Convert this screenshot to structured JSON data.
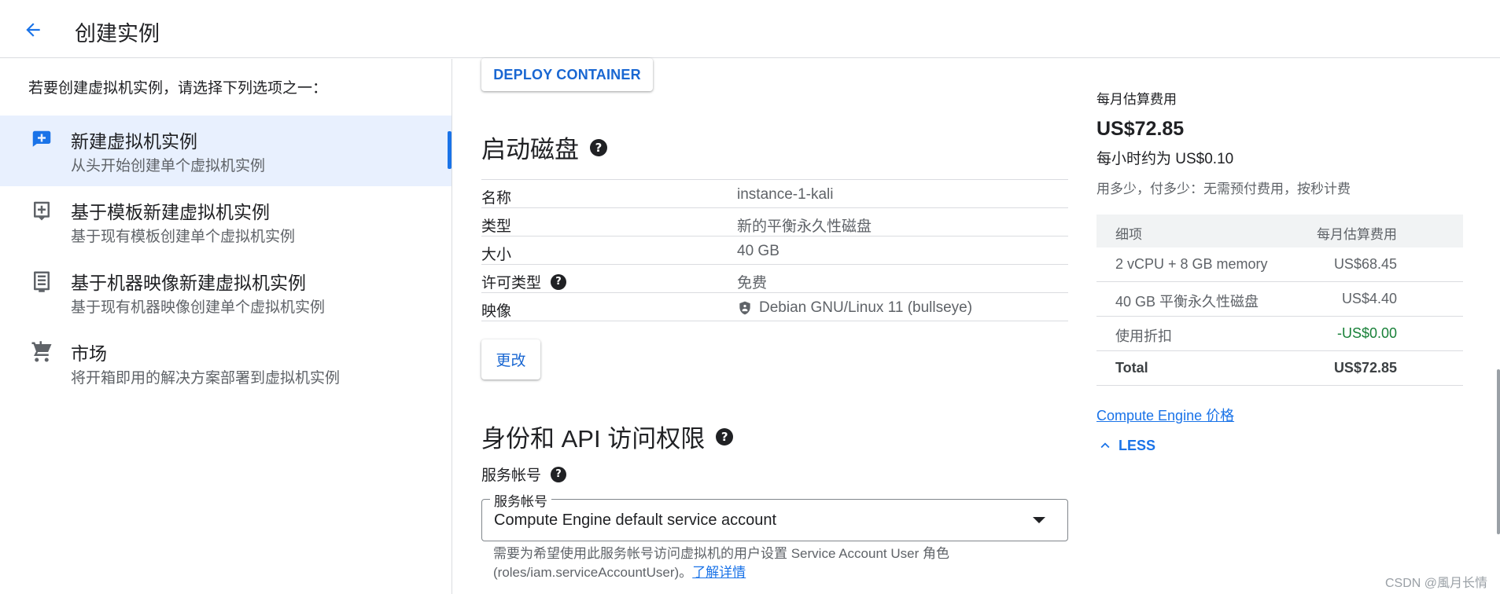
{
  "header": {
    "title": "创建实例"
  },
  "left": {
    "intro": "若要创建虚拟机实例，请选择下列选项之一：",
    "options": [
      {
        "title": "新建虚拟机实例",
        "subtitle": "从头开始创建单个虚拟机实例",
        "icon": "add-box-icon",
        "selected": true
      },
      {
        "title": "基于模板新建虚拟机实例",
        "subtitle": "基于现有模板创建单个虚拟机实例",
        "icon": "template-icon",
        "selected": false
      },
      {
        "title": "基于机器映像新建虚拟机实例",
        "subtitle": "基于现有机器映像创建单个虚拟机实例",
        "icon": "machine-image-icon",
        "selected": false
      },
      {
        "title": "市场",
        "subtitle": "将开箱即用的解决方案部署到虚拟机实例",
        "icon": "cart-icon",
        "selected": false
      }
    ]
  },
  "main": {
    "deploy_button": "DEPLOY CONTAINER",
    "boot_disk": {
      "title": "启动磁盘",
      "rows": [
        {
          "key": "名称",
          "value": "instance-1-kali"
        },
        {
          "key": "类型",
          "value": "新的平衡永久性磁盘"
        },
        {
          "key": "大小",
          "value": "40 GB"
        },
        {
          "key": "许可类型",
          "value": "免费"
        },
        {
          "key": "映像",
          "value": "Debian GNU/Linux 11 (bullseye)"
        }
      ],
      "change_button": "更改"
    },
    "identity": {
      "title": "身份和 API 访问权限",
      "sa_label": "服务帐号",
      "sa_float_label": "服务帐号",
      "sa_value": "Compute Engine default service account",
      "note": "需要为希望使用此服务帐号访问虚拟机的用户设置 Service Account User 角色 (roles/iam.serviceAccountUser)。",
      "note_link": "了解详情"
    }
  },
  "pricing": {
    "monthly_label": "每月估算费用",
    "monthly_price": "US$72.85",
    "hourly": "每小时约为 US$0.10",
    "note": "用多少，付多少：无需预付费用，按秒计费",
    "table_header": {
      "item": "细项",
      "cost": "每月估算费用"
    },
    "rows": [
      {
        "item": "2 vCPU + 8 GB memory",
        "cost": "US$68.45"
      },
      {
        "item": "40 GB 平衡永久性磁盘",
        "cost": "US$4.40"
      },
      {
        "item": "使用折扣",
        "cost": "-US$0.00"
      },
      {
        "item": "Total",
        "cost": "US$72.85"
      }
    ],
    "link": "Compute Engine 价格",
    "less_button": "LESS"
  },
  "watermark": "CSDN @風月长情",
  "colors": {
    "accent": "#1a73e8",
    "selected_bg": "#e8f0fe",
    "discount": "#188038"
  }
}
